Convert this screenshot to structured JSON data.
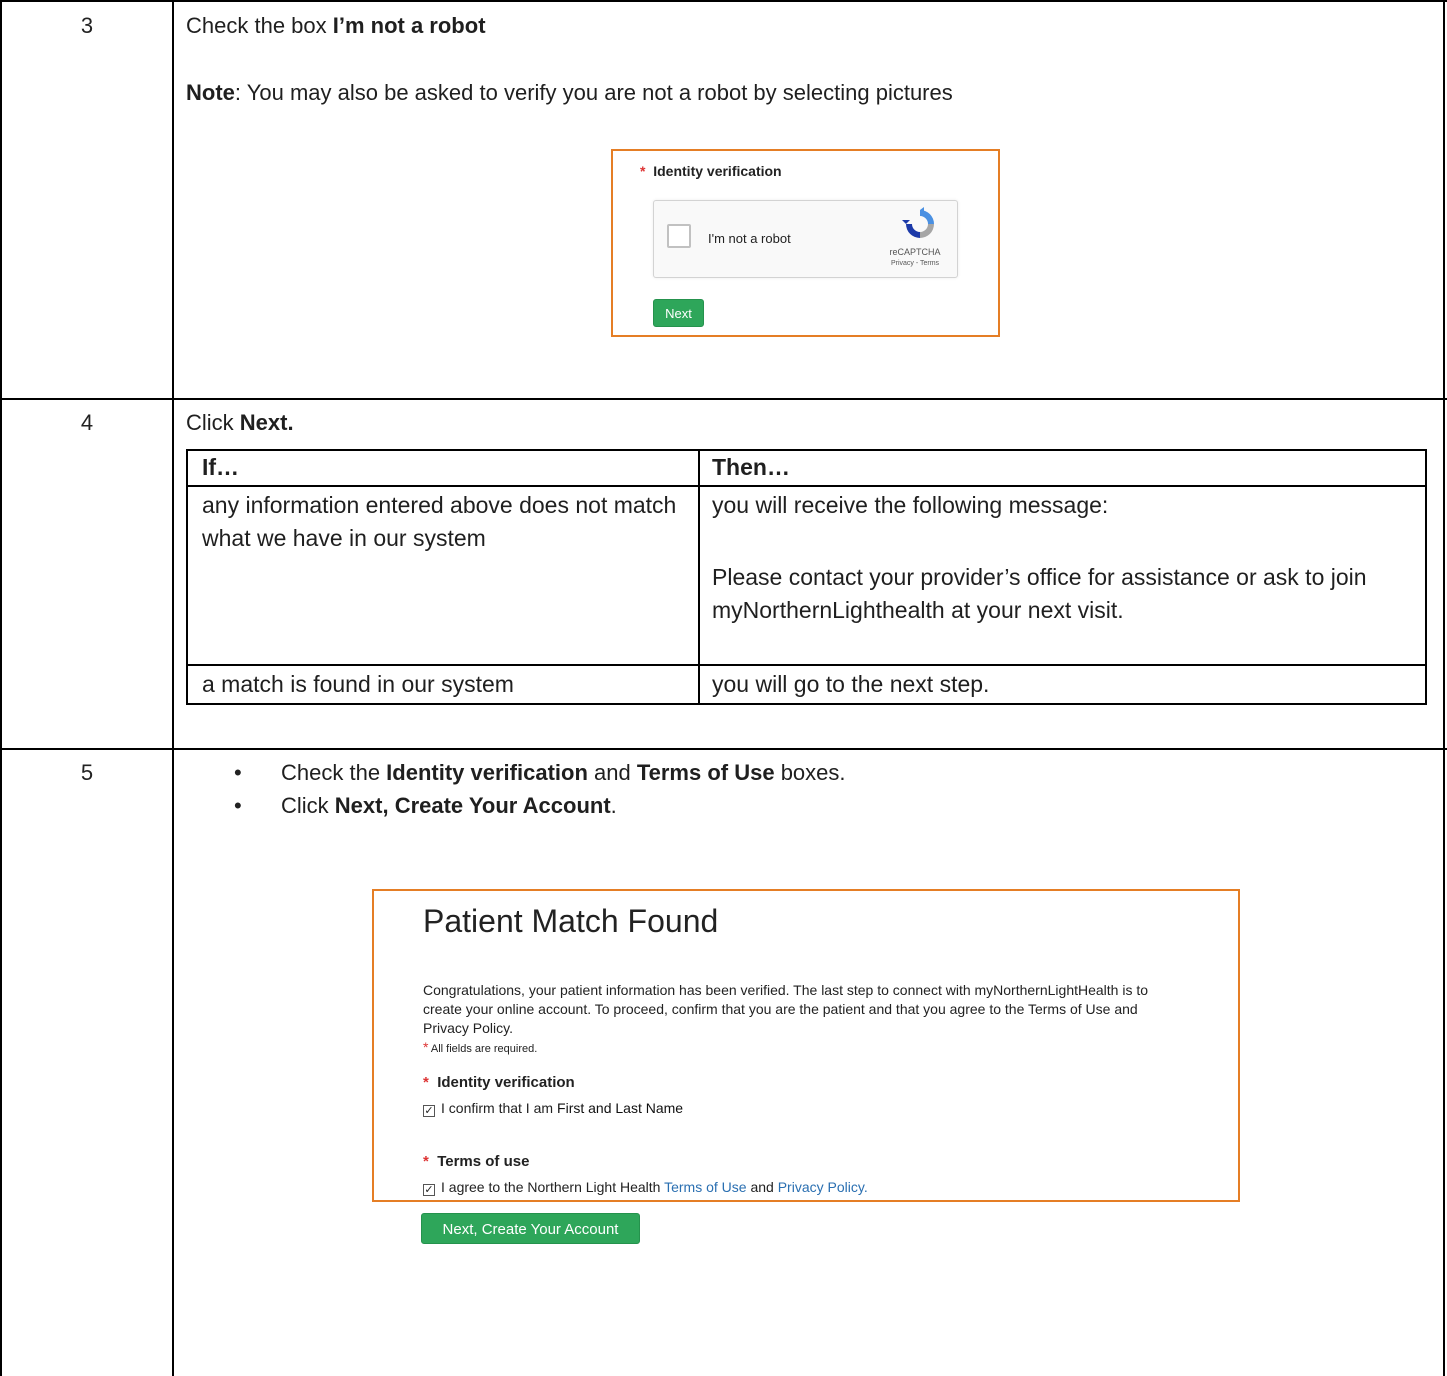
{
  "steps": [
    {
      "number": "3"
    },
    {
      "number": "4"
    },
    {
      "number": "5"
    }
  ],
  "step3": {
    "line1_prefix": "Check the box ",
    "line1_bold": "I’m not a robot",
    "note_bold": "Note",
    "note_text": ":  You may also be asked to verify you are not a robot by selecting pictures",
    "shot": {
      "required_mark": "*",
      "identity_label": "Identity verification",
      "checkbox_label": "I'm not a robot",
      "recaptcha_label": "reCAPTCHA",
      "recaptcha_links": "Privacy - Terms",
      "next_button": "Next"
    }
  },
  "step4": {
    "line_prefix": "Click ",
    "line_bold": "Next.",
    "table": {
      "headers": [
        "If…",
        "Then…"
      ],
      "rows": [
        {
          "if": "any information entered above does not match what we have in our system",
          "then_line1": "you will receive the following message:",
          "then_line2": "Please contact your provider’s office for assistance or ask to join myNorthernLighthealth at your next visit."
        },
        {
          "if": "a match is found in our system",
          "then_line1": "you will go to the next step."
        }
      ]
    }
  },
  "step5": {
    "bullets": [
      {
        "prefix": "Check the ",
        "bold1": "Identity verification",
        "mid": " and ",
        "bold2": "Terms of Use",
        "suffix": " boxes."
      },
      {
        "prefix": "Click ",
        "bold1": "Next, Create Your Account",
        "suffix": "."
      }
    ],
    "shot": {
      "title": "Patient Match Found",
      "body": "Congratulations, your patient information has been verified. The last step to connect with myNorthernLightHealth is to create your online account. To proceed, confirm that you are the patient and that you agree to the Terms of Use and Privacy Policy.",
      "required_mark": "*",
      "all_required": "All fields are required.",
      "identity_label": "Identity verification",
      "identity_check": "I confirm that I am",
      "identity_name": "First and Last Name",
      "terms_label": "Terms of use",
      "terms_check_prefix": "I agree to the Northern Light Health",
      "terms_link": "Terms of Use",
      "terms_and": "and",
      "privacy_link": "Privacy Policy",
      "terms_end": ".",
      "button": "Next, Create Your Account"
    }
  }
}
